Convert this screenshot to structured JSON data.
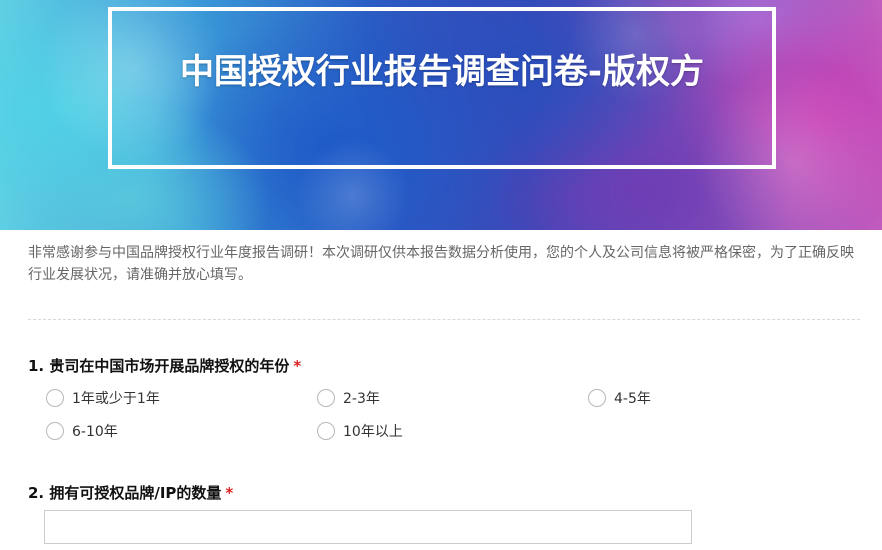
{
  "header": {
    "title": "中国授权行业报告调查问卷-版权方"
  },
  "intro": {
    "text": "非常感谢参与中国品牌授权行业年度报告调研！本次调研仅供本报告数据分析使用，您的个人及公司信息将被严格保密，为了正确反映行业发展状况，请准确并放心填写。"
  },
  "questions": [
    {
      "title": "1. 贵司在中国市场开展品牌授权的年份",
      "required": "*",
      "options": [
        "1年或少于1年",
        "2-3年",
        "4-5年",
        "6-10年",
        "10年以上"
      ]
    },
    {
      "title": "2. 拥有可授权品牌/IP的数量",
      "required": "*",
      "value": ""
    }
  ],
  "colors": {
    "required": "#e02020",
    "intro_text": "#666666",
    "title_text": "#ffffff"
  }
}
